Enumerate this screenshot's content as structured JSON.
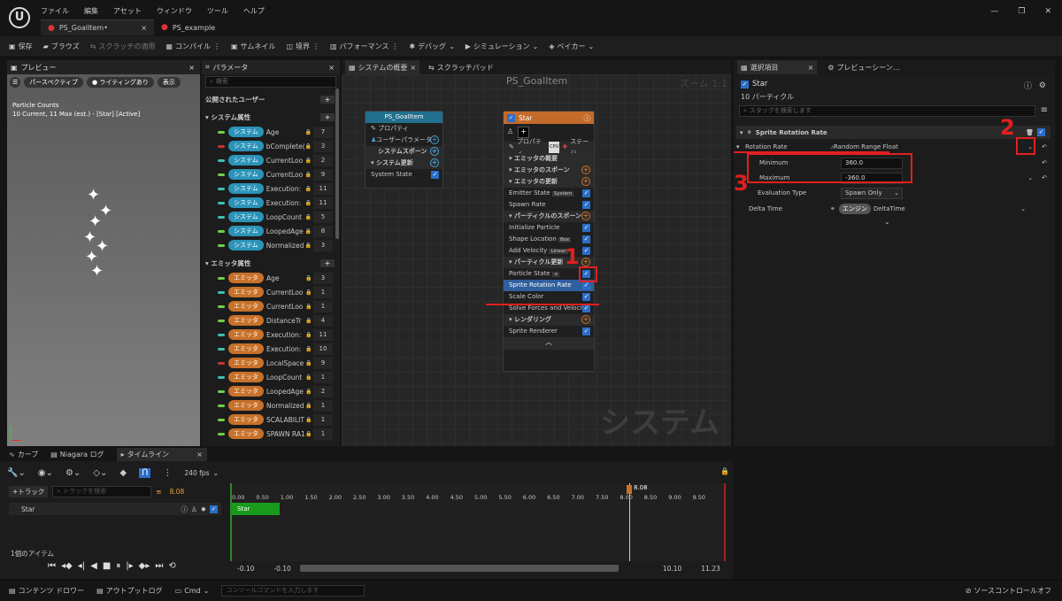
{
  "menu": [
    "ファイル",
    "編集",
    "アセット",
    "ウィンドウ",
    "ツール",
    "ヘルプ"
  ],
  "doc_tabs": [
    "PS_GoalItem•",
    "PS_example"
  ],
  "toolbar": {
    "save": "保存",
    "browse": "ブラウズ",
    "apply_scratch": "スクラッチの適用",
    "compile": "コンパイル",
    "thumbnail": "サムネイル",
    "bounds": "境界",
    "performance": "パフォーマンス",
    "debug": "デバッグ",
    "simulation": "シミュレーション",
    "baker": "ベイカー"
  },
  "preview": {
    "tab": "プレビュー",
    "perspective": "パースペクティブ",
    "lighting": "ライティングあり",
    "show": "表示",
    "particle_counts": "Particle Counts",
    "counts_detail": "10 Current, 11 Max (est.) - [Star] [Active]"
  },
  "params": {
    "tab": "パラメータ",
    "search": "検索",
    "exposed_users": "公開されたユーザー",
    "system_attrs": "システム属性",
    "emitter_attrs": "エミッタ属性",
    "sys_label": "システム",
    "emi_label": "エミッタ",
    "system_rows": [
      {
        "name": "Age",
        "n": "7",
        "c": "#6fcf4a"
      },
      {
        "name": "bComplete(",
        "n": "3",
        "c": "#c83232"
      },
      {
        "name": "CurrentLoo",
        "n": "2",
        "c": "#3fbfb0"
      },
      {
        "name": "CurrentLoo",
        "n": "9",
        "c": "#6fcf4a"
      },
      {
        "name": "Execution:",
        "n": "11",
        "c": "#3fbfb0"
      },
      {
        "name": "Execution:",
        "n": "11",
        "c": "#3fbfb0"
      },
      {
        "name": "LoopCount",
        "n": "5",
        "c": "#3fbfb0"
      },
      {
        "name": "LoopedAge",
        "n": "8",
        "c": "#6fcf4a"
      },
      {
        "name": "Normalized",
        "n": "3",
        "c": "#6fcf4a"
      }
    ],
    "emitter_rows": [
      {
        "name": "Age",
        "n": "3",
        "c": "#6fcf4a"
      },
      {
        "name": "CurrentLoo",
        "n": "1",
        "c": "#3fbfb0"
      },
      {
        "name": "CurrentLoo",
        "n": "1",
        "c": "#6fcf4a"
      },
      {
        "name": "DistanceTr",
        "n": "4",
        "c": "#6fcf4a"
      },
      {
        "name": "Execution:",
        "n": "11",
        "c": "#3fbfb0"
      },
      {
        "name": "Execution:",
        "n": "10",
        "c": "#3fbfb0"
      },
      {
        "name": "LocalSpace",
        "n": "9",
        "c": "#c83232"
      },
      {
        "name": "LoopCount",
        "n": "1",
        "c": "#3fbfb0"
      },
      {
        "name": "LoopedAge",
        "n": "2",
        "c": "#6fcf4a"
      },
      {
        "name": "Normalized",
        "n": "1",
        "c": "#6fcf4a"
      },
      {
        "name": "SCALABILIT",
        "n": "1",
        "c": "#6fcf4a"
      },
      {
        "name": "SPAWN RA1",
        "n": "1",
        "c": "#6fcf4a"
      }
    ]
  },
  "graph": {
    "tab1": "システムの概要",
    "tab2": "スクラッチパッド",
    "title": "PS_GoalItem",
    "zoom": "ズーム 1:1",
    "watermark": "システム",
    "sysnode": {
      "title": "PS_GoalItem",
      "rows": [
        "プロパティ",
        "ユーザーパラメータ",
        "システムスポーン",
        "システム更新",
        "System State"
      ]
    },
    "star": {
      "title": "Star",
      "props": "プロパティ",
      "cpu": "CPU",
      "stage": "ステージ",
      "rows": [
        {
          "t": "エミッタの概要",
          "h": true
        },
        {
          "t": "エミッタのスポーン",
          "h": true,
          "plus": true
        },
        {
          "t": "エミッタの更新",
          "h": true,
          "plus": true
        },
        {
          "t": "Emitter State",
          "tag": "System"
        },
        {
          "t": "Spawn Rate"
        },
        {
          "t": "パーティクルのスポーン",
          "h": true,
          "plus": true
        },
        {
          "t": "Initialize Particle"
        },
        {
          "t": "Shape Location",
          "tag": "Box"
        },
        {
          "t": "Add Velocity",
          "tag": "Linear"
        },
        {
          "t": "パーティクル更新",
          "h": true,
          "plus": true
        },
        {
          "t": "Particle State",
          "tag": "+"
        },
        {
          "t": "Sprite Rotation Rate",
          "sel": true
        },
        {
          "t": "Scale Color"
        },
        {
          "t": "Solve Forces and Velocity"
        },
        {
          "t": "レンダリング",
          "h": true,
          "plus": true
        },
        {
          "t": "Sprite Renderer"
        }
      ]
    }
  },
  "details": {
    "tab1": "選択項目",
    "tab2": "プレビューシーン…",
    "name": "Star",
    "count": "10 パーティクル",
    "search": "スタックを検索します",
    "module": "Sprite Rotation Rate",
    "rot_rate": "Rotation Rate",
    "rot_value": "Random Range Float",
    "min_label": "Minimum",
    "min_value": "360.0",
    "max_label": "Maximum",
    "max_value": "-360.0",
    "eval_label": "Evaluation Type",
    "eval_value": "Spawn Only",
    "delta_label": "Delta Time",
    "engine": "エンジン",
    "delta_value": "DeltaTime"
  },
  "annotations": [
    "1",
    "2",
    "3"
  ],
  "bottom": {
    "tabs": [
      "カーブ",
      "Niagara ログ",
      "タイムライン"
    ],
    "fps": "240 fps",
    "add_track": "+トラック",
    "track_search": "トラックを検索",
    "time": "8.08",
    "track": "Star",
    "clip": "Star",
    "items": "1個のアイテム",
    "ticks": [
      "0.00",
      "0.50",
      "1.00",
      "1.50",
      "2.00",
      "2.50",
      "3.00",
      "3.50",
      "4.00",
      "4.50",
      "5.00",
      "5.50",
      "6.00",
      "6.50",
      "7.00",
      "7.50",
      "8.00",
      "8.50",
      "9.00",
      "9.50"
    ],
    "range": [
      "-0.10",
      "-0.10",
      "10.10",
      "11.23"
    ]
  },
  "status": {
    "content": "コンテンツ ドロワー",
    "output": "アウトプットログ",
    "cmd": "Cmd",
    "console": "コンソールコマンドを入力します",
    "source": "ソースコントロールオフ"
  }
}
